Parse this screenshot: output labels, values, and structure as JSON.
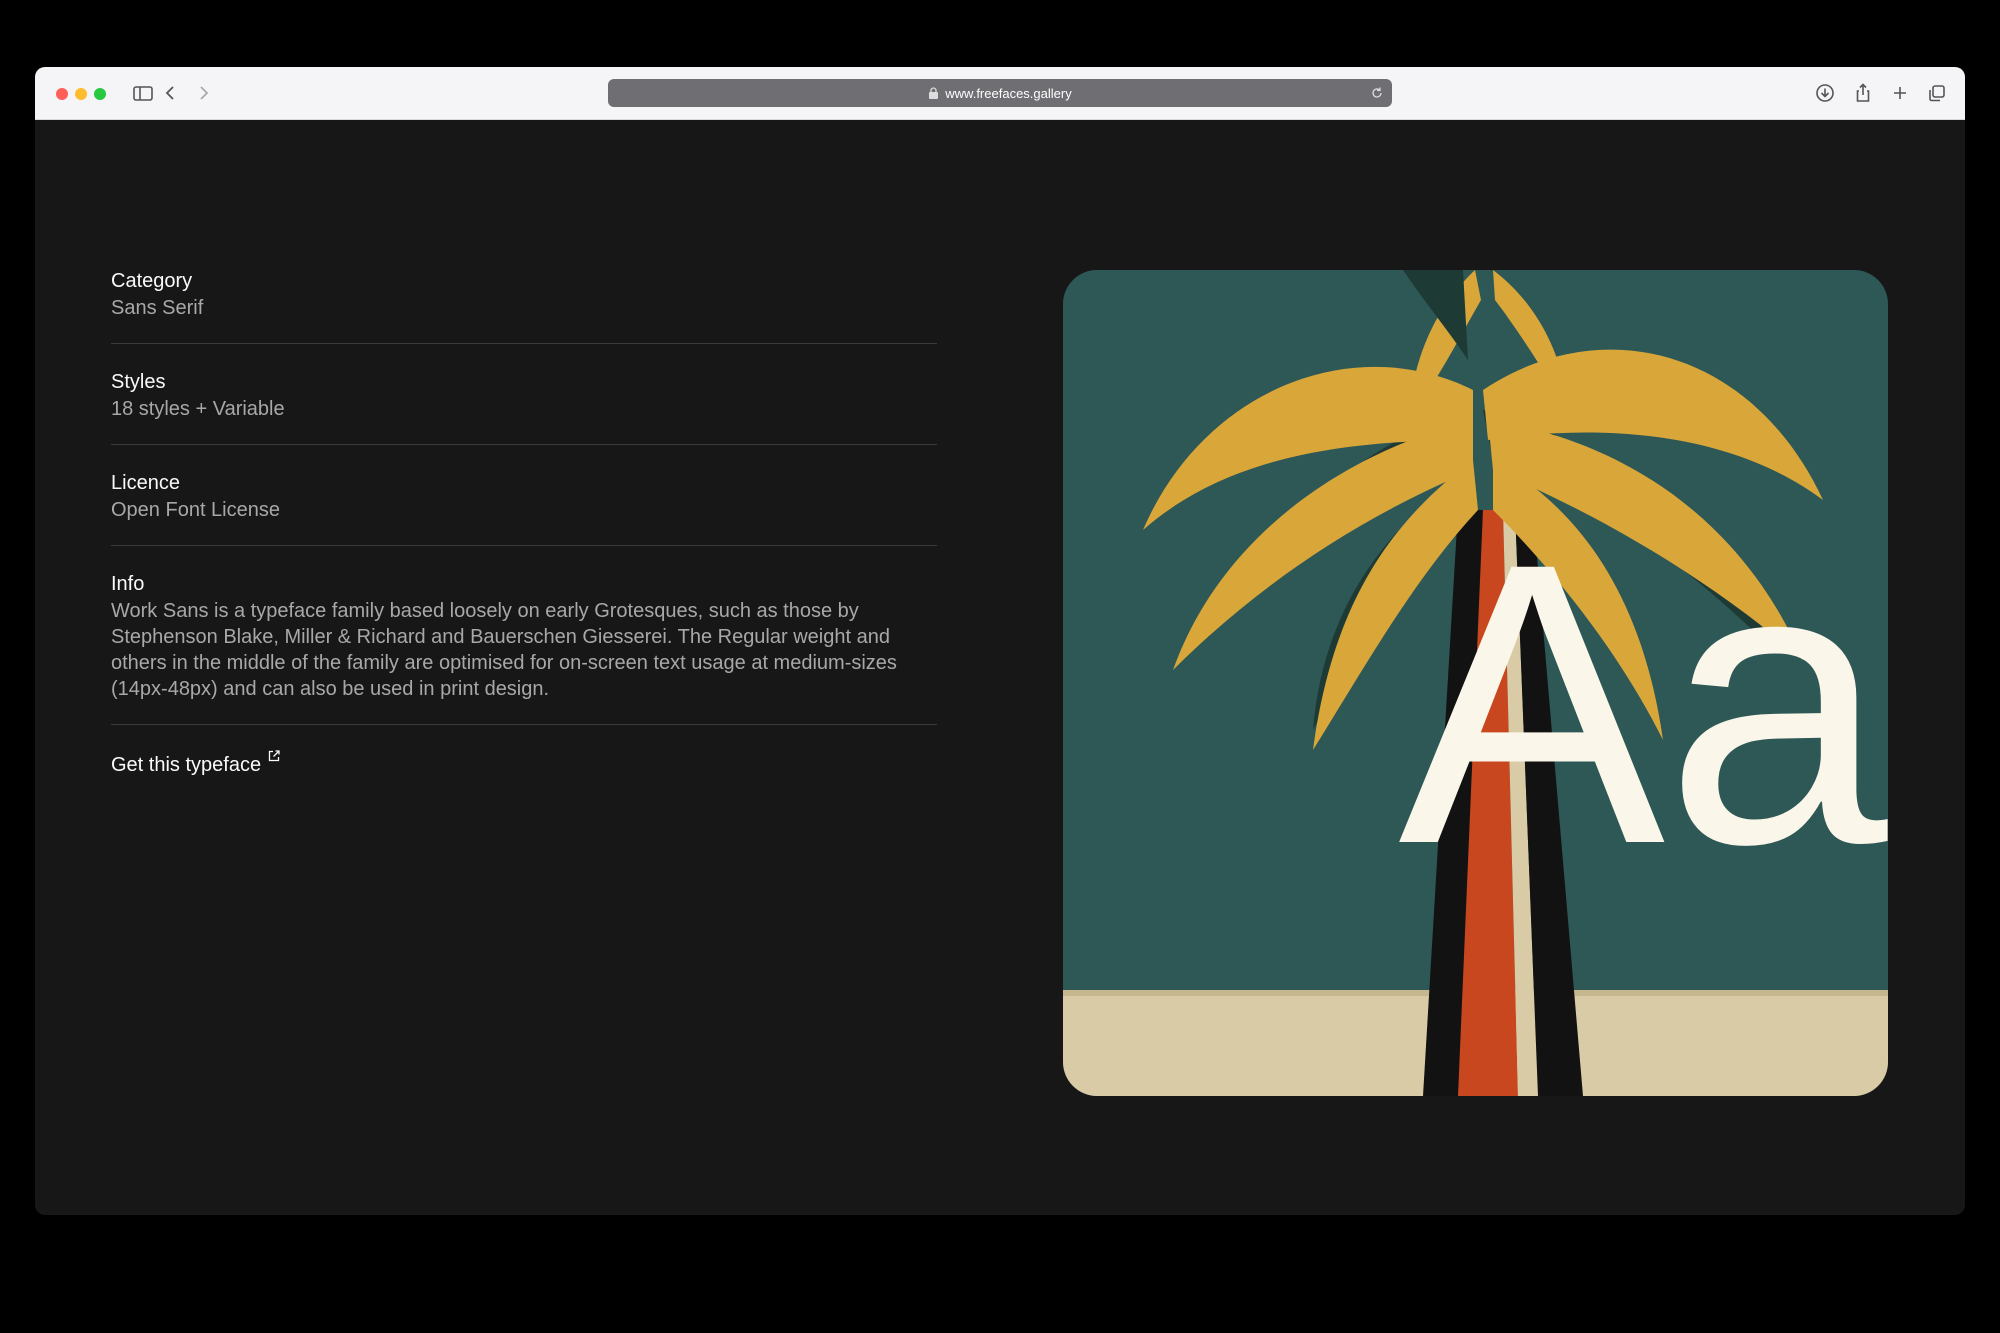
{
  "browser": {
    "url": "www.freefaces.gallery",
    "icons": [
      "sidebar-icon",
      "back-icon",
      "forward-icon",
      "lock-icon",
      "reload-icon",
      "download-icon",
      "share-icon",
      "new-tab-icon",
      "tabs-overview-icon"
    ]
  },
  "details": [
    {
      "label": "Category",
      "value": "Sans Serif"
    },
    {
      "label": "Styles",
      "value": "18 styles + Variable"
    },
    {
      "label": "Licence",
      "value": "Open Font License"
    }
  ],
  "info": {
    "label": "Info",
    "value": "Work Sans is a typeface family based loosely on early Grotesques, such as those by Stephenson Blake, Miller & Richard and Bauerschen Giesserei. The Regular weight and others in the middle of the family are optimised for on-screen text usage at medium-sizes (14px-48px) and can also be used in print design."
  },
  "cta": {
    "label": "Get this typeface",
    "icon": "external-link-icon"
  },
  "preview": {
    "glyphs": "Aa",
    "colors": {
      "sky": "#2f5d5a",
      "sand": "#d9cba6",
      "leaf": "#d9a63a",
      "trunk": "#c8471f",
      "glyph": "#fbf6ea"
    }
  }
}
